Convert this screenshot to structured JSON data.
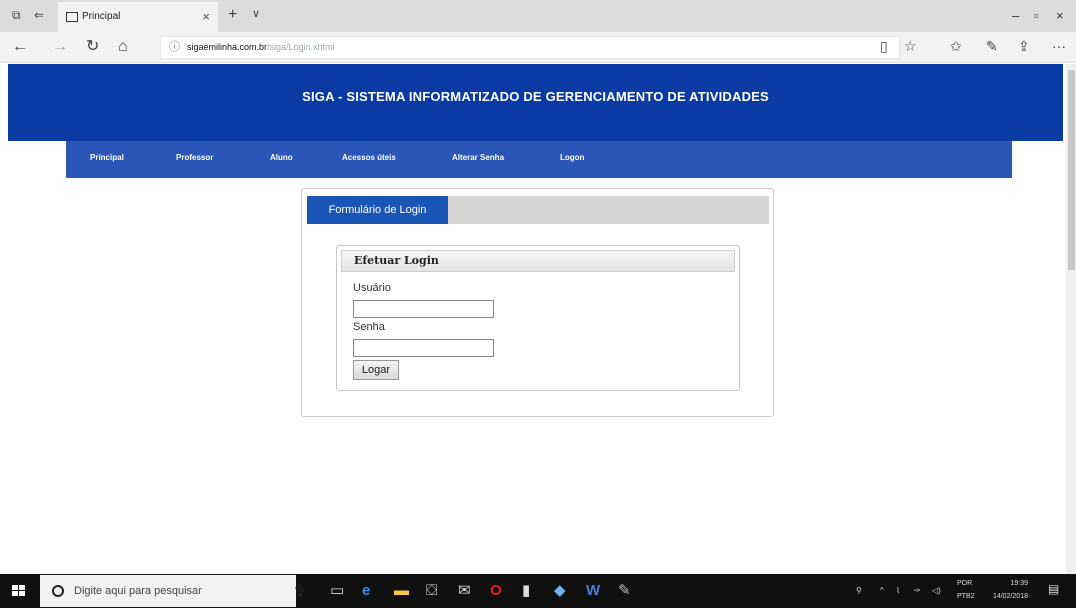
{
  "browser": {
    "tab_title": "Principal",
    "tab_close": "×",
    "new_tab": "+",
    "tab_dropdown": "∨",
    "url_host": "sigaemilinha.com.br",
    "url_path": "/siga/Login.xhtml",
    "window_minimize": "–",
    "window_maximize": "▫",
    "window_close": "×",
    "more": "···"
  },
  "page": {
    "header_title": "SIGA - SISTEMA INFORMATIZADO DE GERENCIAMENTO DE ATIVIDADES",
    "menu": [
      "Principal",
      "Professor",
      "Aluno",
      "Acessos úteis",
      "Alterar Senha",
      "Logon"
    ],
    "form_tab": "Formulário de Login",
    "login_heading": "Efetuar Login",
    "user_label": "Usuário",
    "user_value": "",
    "password_label": "Senha",
    "password_value": "",
    "submit_label": "Logar"
  },
  "taskbar": {
    "search_placeholder": "Digite aqui para pesquisar",
    "lang_top": "POR",
    "lang_bottom": "PTB2",
    "time": "19:39",
    "date": "14/02/2018"
  },
  "colors": {
    "header_bg": "#0a3aa4",
    "menu_bg": "#2a56b8",
    "form_tab_bg": "#1b56b7"
  }
}
